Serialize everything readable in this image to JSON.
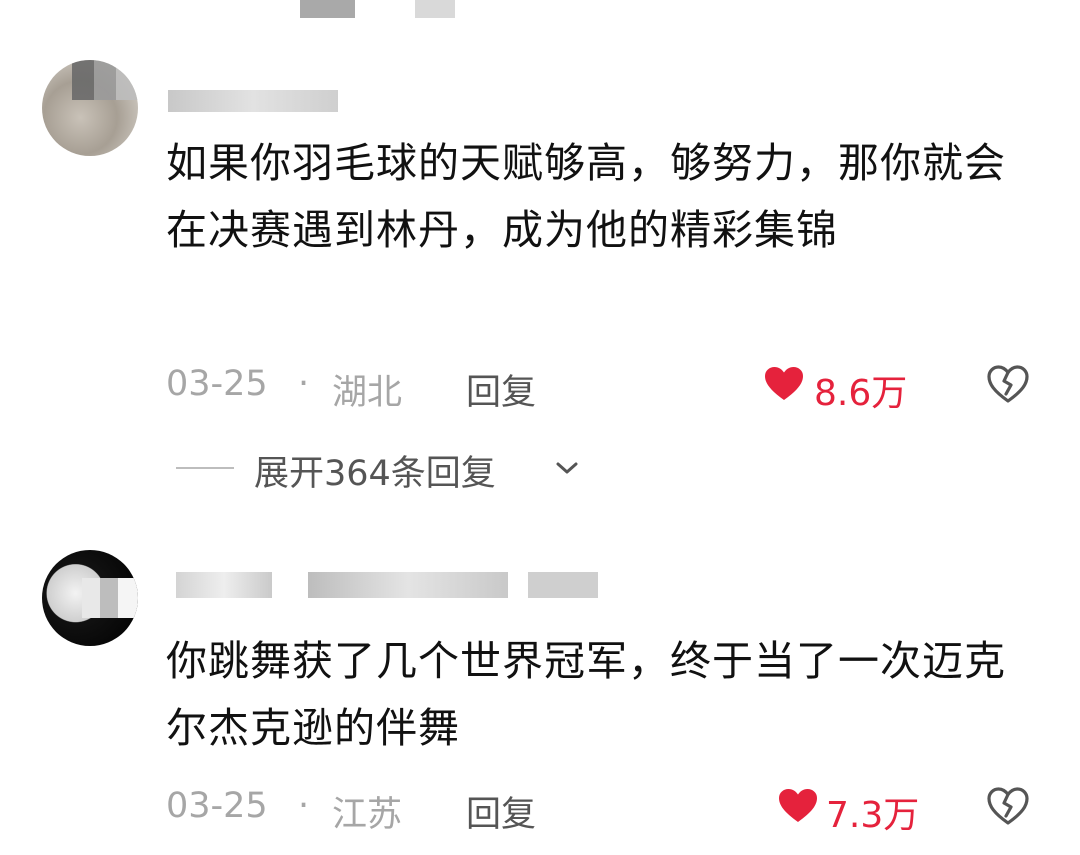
{
  "comments": [
    {
      "text": "如果你羽毛球的天赋够高，够努力，那你就会在决赛遇到林丹，成为他的精彩集锦",
      "date": "03-25",
      "separator": "·",
      "location": "湖北",
      "reply_label": "回复",
      "likes": "8.6万",
      "expand_replies": "展开364条回复"
    },
    {
      "text": "你跳舞获了几个世界冠军，终于当了一次迈克尔杰克逊的伴舞",
      "date": "03-25",
      "separator": "·",
      "location": "江苏",
      "reply_label": "回复",
      "likes": "7.3万"
    }
  ],
  "icons": {
    "like": "heart-icon",
    "dislike": "broken-heart-icon",
    "expand": "chevron-down-icon"
  },
  "colors": {
    "like_red": "#e5223c",
    "meta_gray": "#a6a6a6",
    "text": "#111111"
  }
}
